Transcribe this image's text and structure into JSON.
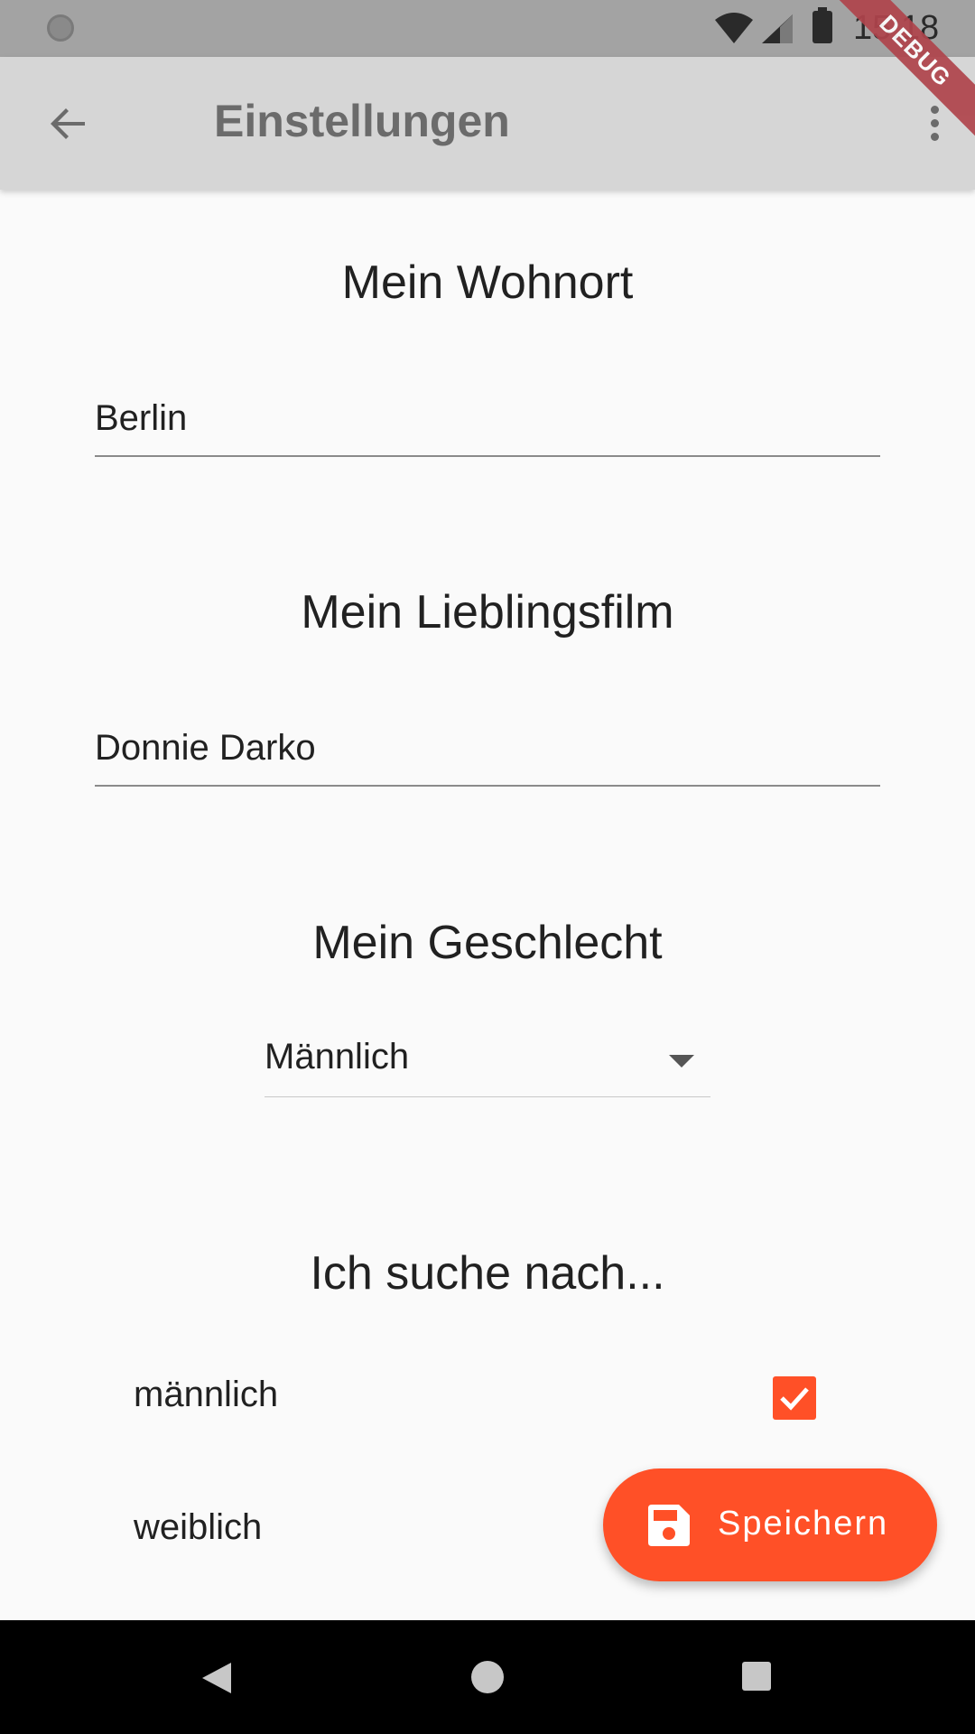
{
  "status_bar": {
    "time": "15:18"
  },
  "app_bar": {
    "title": "Einstellungen"
  },
  "debug_banner": {
    "label": "DEBUG"
  },
  "wohnort": {
    "title": "Mein Wohnort",
    "value": "Berlin"
  },
  "lieblingsfilm": {
    "title": "Mein Lieblingsfilm",
    "value": "Donnie Darko"
  },
  "geschlecht": {
    "title": "Mein Geschlecht",
    "selected": "Männlich"
  },
  "suche": {
    "title": "Ich suche nach...",
    "options": [
      {
        "label": "männlich",
        "checked": true
      },
      {
        "label": "weiblich",
        "checked": false
      }
    ]
  },
  "fab": {
    "label": "Speichern",
    "icon": "save-icon"
  },
  "colors": {
    "accent": "#ff5027",
    "app_bar": "#d6d6d6",
    "status_bar": "#a3a3a3"
  }
}
